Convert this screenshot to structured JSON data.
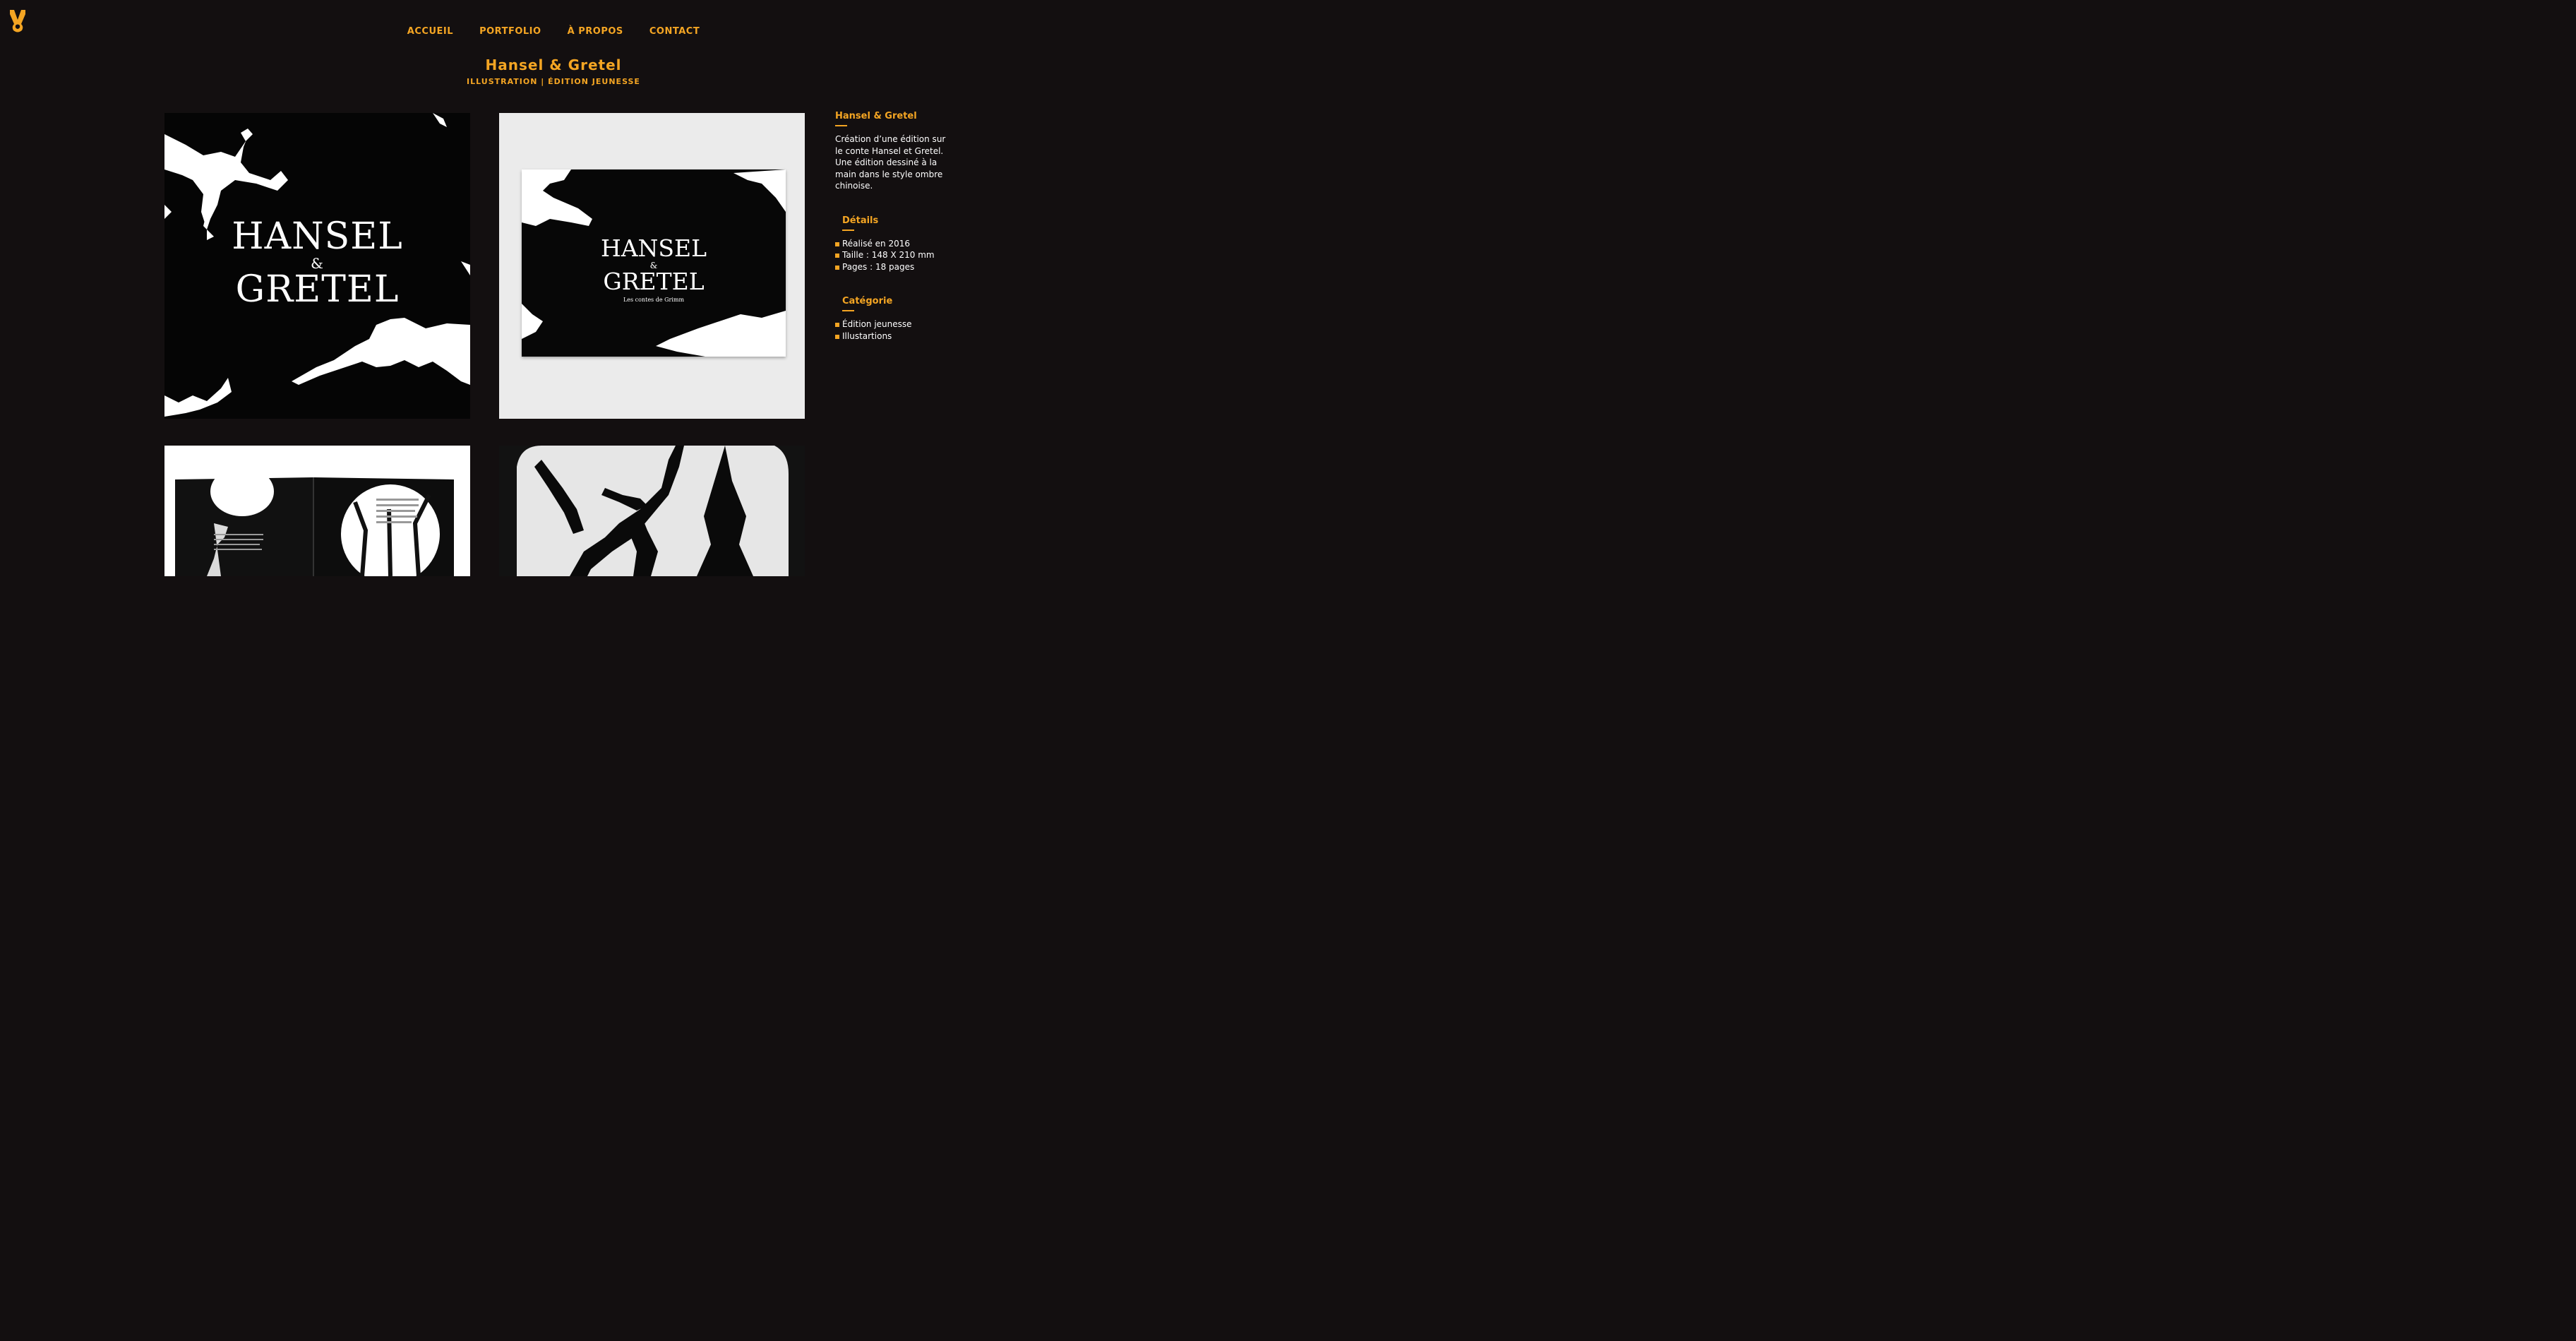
{
  "nav": {
    "items": [
      "ACCUEIL",
      "PORTFOLIO",
      "À PROPOS",
      "CONTACT"
    ]
  },
  "header": {
    "title": "Hansel & Gretel",
    "subtitle": "ILLUSTRATION | ÉDITION JEUNESSE"
  },
  "gallery": {
    "cover": {
      "line1": "HANSEL",
      "amp": "&",
      "line2": "GRETEL"
    },
    "book": {
      "line1": "HANSEL",
      "amp": "&",
      "line2": "GRETEL",
      "small": "Les contes de Grimm"
    }
  },
  "sidebar": {
    "title": "Hansel & Gretel",
    "description": "Création d’une édition sur le conte Hansel et Gretel. Une édition dessiné à la main dans le style ombre chinoise.",
    "details": {
      "heading": "Détails",
      "items": [
        "Réalisé en 2016",
        "Taille : 148 X 210 mm",
        "Pages : 18 pages"
      ]
    },
    "categorie": {
      "heading": "Catégorie",
      "items": [
        "Édition jeunesse",
        "Illustartions"
      ]
    }
  },
  "colors": {
    "accent": "#f4a523",
    "background": "#130f10"
  }
}
